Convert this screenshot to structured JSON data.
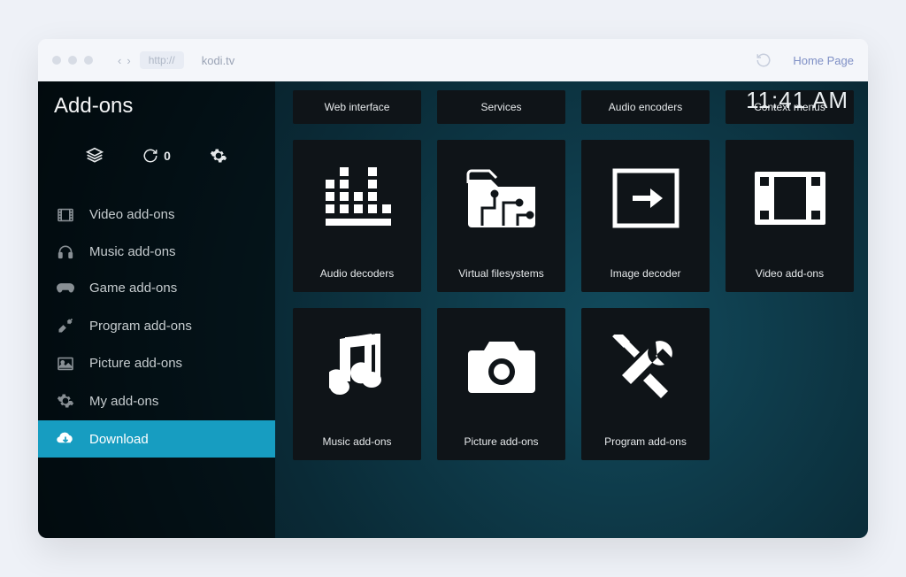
{
  "browser": {
    "scheme": "http://",
    "url": "kodi.tv",
    "home_label": "Home Page"
  },
  "sidebar": {
    "title": "Add-ons",
    "refresh_count": "0",
    "items": [
      {
        "label": "Video add-ons",
        "icon": "film-icon"
      },
      {
        "label": "Music add-ons",
        "icon": "headphones-icon"
      },
      {
        "label": "Game add-ons",
        "icon": "gamepad-icon"
      },
      {
        "label": "Program add-ons",
        "icon": "tools-icon"
      },
      {
        "label": "Picture add-ons",
        "icon": "image-icon"
      },
      {
        "label": "My add-ons",
        "icon": "gear-icon"
      },
      {
        "label": "Download",
        "icon": "cloud-download-icon"
      }
    ]
  },
  "clock": "11:41 AM",
  "tiles_small": [
    {
      "label": "Web interface"
    },
    {
      "label": "Services"
    },
    {
      "label": "Audio encoders"
    },
    {
      "label": "Context menus"
    }
  ],
  "tiles_row1": [
    {
      "label": "Audio decoders",
      "icon": "equalizer-icon"
    },
    {
      "label": "Virtual filesystems",
      "icon": "folder-circuit-icon"
    },
    {
      "label": "Image decoder",
      "icon": "image-decoder-icon"
    },
    {
      "label": "Video add-ons",
      "icon": "film-strip-icon"
    }
  ],
  "tiles_row2": [
    {
      "label": "Music add-ons",
      "icon": "music-note-icon"
    },
    {
      "label": "Picture add-ons",
      "icon": "camera-icon"
    },
    {
      "label": "Program add-ons",
      "icon": "hammer-wrench-icon"
    }
  ]
}
